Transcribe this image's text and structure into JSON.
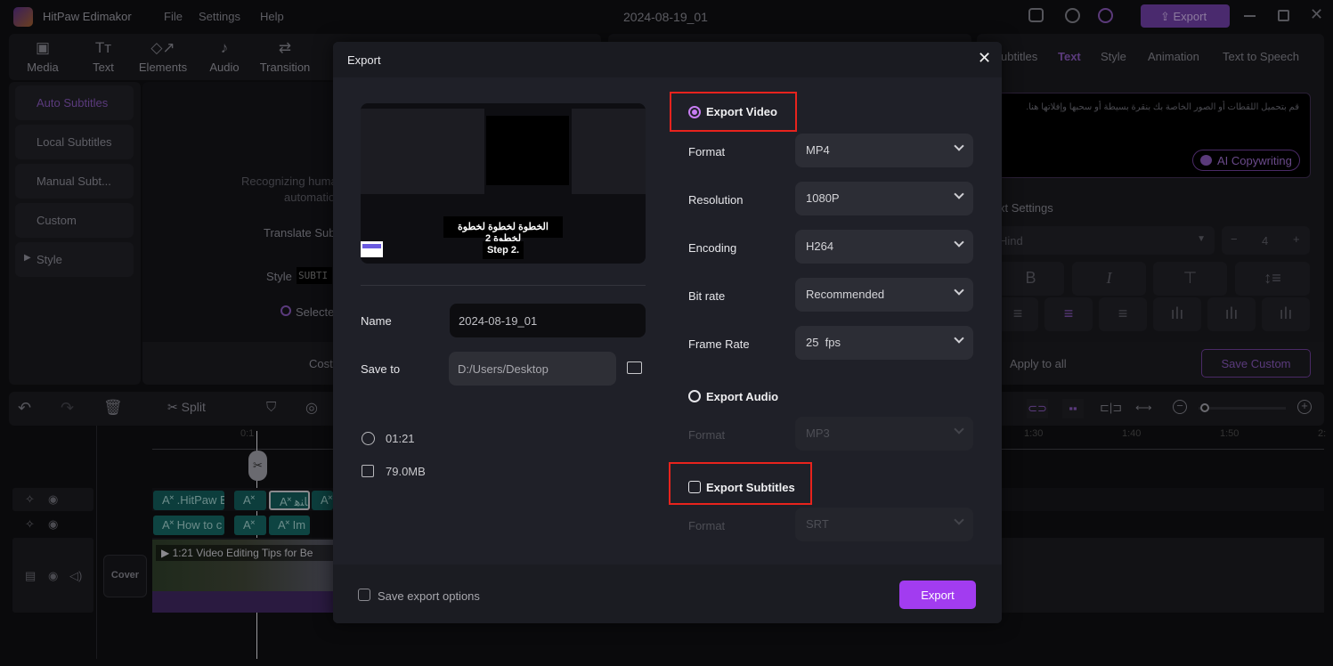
{
  "app": {
    "name": "HitPaw Edimakor",
    "menu": [
      "File",
      "Settings",
      "Help"
    ],
    "project_title": "2024-08-19_01",
    "export_label": "Export"
  },
  "toolbar": [
    "Media",
    "Text",
    "Elements",
    "Audio",
    "Transition"
  ],
  "sidebar": [
    "Auto Subtitles",
    "Local Subtitles",
    "Manual Subt...",
    "Custom",
    "Style"
  ],
  "middle": {
    "desc1": "Recognizing huma",
    "desc2": "automatio",
    "translate": "Translate Sub",
    "style": "Style",
    "style_preview": "SUBTI",
    "selected": "Selecte",
    "cost": "Cost"
  },
  "right_panel": {
    "tabs": [
      "ubtitles",
      "Text",
      "Style",
      "Animation",
      "Text to Speech"
    ],
    "arabic_text": "قم بتحميل اللقطات أو الصور الخاصة بك بنقرة بسيطة أو سحبها وإفلاتها هنا.",
    "ai_copywriting": "AI Copywriting",
    "text_settings": "xt Settings",
    "font": "Hind",
    "font_size": "4",
    "apply_all": "Apply to all",
    "save_custom": "Save Custom"
  },
  "timeline": {
    "split": "Split",
    "ticks": [
      "1:30",
      "1:40",
      "1:50",
      "2:"
    ],
    "playhead_label": "0:1",
    "clips_row1": [
      ".HitPaw E",
      "",
      "ﺎﻨﻫ.",
      " "
    ],
    "clips_row2": [
      "How to c",
      "",
      "Im",
      ""
    ],
    "video_clip": "1:21 Video Editing Tips for Be",
    "cover": "Cover"
  },
  "dialog": {
    "title": "Export",
    "preview": {
      "caption_arabic": "الخطوة لخطوة لخطوة لخطوة 2",
      "caption": "Step 2."
    },
    "name_label": "Name",
    "name_value": "2024-08-19_01",
    "save_to_label": "Save to",
    "save_to_value": "D:/Users/Desktop",
    "duration": "01:21",
    "size": "79.0MB",
    "export_video": {
      "label": "Export Video",
      "selected": true,
      "fields": [
        {
          "label": "Format",
          "value": "MP4"
        },
        {
          "label": "Resolution",
          "value": "1080P"
        },
        {
          "label": "Encoding",
          "value": "H264"
        },
        {
          "label": "Bit rate",
          "value": "Recommended"
        },
        {
          "label": "Frame Rate",
          "value": "25  fps"
        }
      ]
    },
    "export_audio": {
      "label": "Export Audio",
      "selected": false,
      "format_label": "Format",
      "format_value": "MP3"
    },
    "export_subtitles": {
      "label": "Export Subtitles",
      "checked": false,
      "format_label": "Format",
      "format_value": "SRT"
    },
    "save_options": "Save export options",
    "export_button": "Export"
  },
  "colors": {
    "accent": "#a23cf0",
    "highlight_box": "#e8231d",
    "dialog_bg": "#1f2028"
  }
}
